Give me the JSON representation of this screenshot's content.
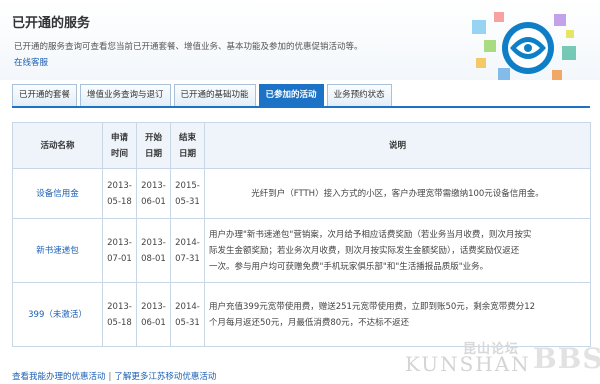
{
  "header": {
    "title": "已开通的服务",
    "description": "已开通的服务查询可查看您当前已开通套餐、增值业务、基本功能及参加的优惠促销活动等。",
    "service_link": "在线客服"
  },
  "tabs": [
    {
      "label": "已开通的套餐",
      "active": false
    },
    {
      "label": "增值业务查询与退订",
      "active": false
    },
    {
      "label": "已开通的基础功能",
      "active": false
    },
    {
      "label": "已参加的活动",
      "active": true
    },
    {
      "label": "业务预约状态",
      "active": false
    }
  ],
  "table": {
    "headers": {
      "name": "活动名称",
      "apply_line1": "申请",
      "apply_line2": "时间",
      "start_line1": "开始",
      "start_line2": "日期",
      "end_line1": "结束",
      "end_line2": "日期",
      "desc": "说明"
    },
    "rows": [
      {
        "name": "设备信用金",
        "apply": [
          "2013-",
          "05-18"
        ],
        "start": [
          "2013-",
          "06-01"
        ],
        "end": [
          "2015-",
          "05-31"
        ],
        "desc": [
          "光纤到户（FTTH）接入方式的小区，客户办理宽带需缴纳100元设备信用金。"
        ]
      },
      {
        "name": "新书速递包",
        "apply": [
          "2013-",
          "07-01"
        ],
        "start": [
          "2013-",
          "08-01"
        ],
        "end": [
          "2014-",
          "07-31"
        ],
        "desc": [
          "用户办理\"新书速递包\"营销案，次月给予相应话费奖励（若业务当月收费，则次月按实",
          "际发生金额奖励；若业务次月收费，则次月按实际发生金额奖励），话费奖励仅返还",
          "一次。参与用户均可获赠免费\"手机玩家俱乐部\"和\"生活播报品质版\"业务。"
        ]
      },
      {
        "name": "399（未激活）",
        "apply": [
          "2013-",
          "05-18"
        ],
        "start": [
          "2013-",
          "06-01"
        ],
        "end": [
          "2014-",
          "05-31"
        ],
        "desc": [
          "用户充值399元宽带使用费，赠送251元宽带使用费，立即到账50元，剩余宽带费分12",
          "个月每月返还50元，月最低消费80元，不达标不返还"
        ]
      }
    ]
  },
  "footer": {
    "link1": "查看我能办理的优惠活动",
    "link2": "了解更多江苏移动优惠活动"
  },
  "watermark": {
    "cn": "昆山论坛",
    "en": "KUNSHAN",
    "bbs": "BBS"
  },
  "colors": {
    "accent": "#1b72c6",
    "link": "#1a5fb4",
    "border": "#c7d7e6"
  }
}
